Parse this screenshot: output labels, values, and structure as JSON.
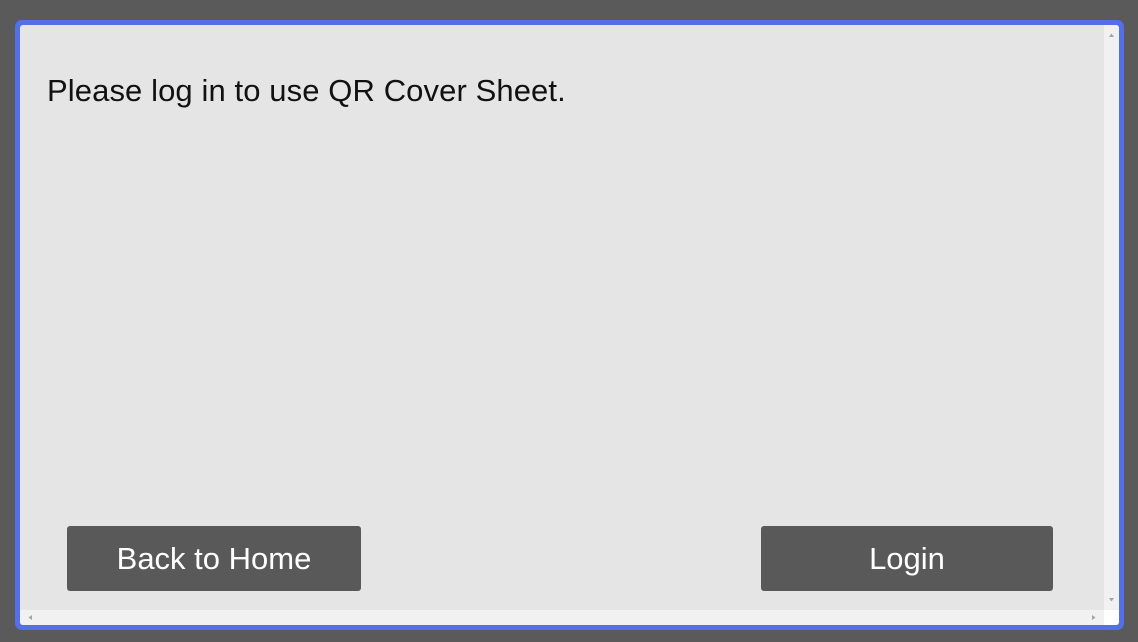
{
  "dialog": {
    "message": "Please log in to use QR Cover Sheet.",
    "back_label": "Back to Home",
    "login_label": "Login"
  },
  "colors": {
    "background": "#5a5a5a",
    "frame_border": "#5470e8",
    "panel": "#e5e5e5",
    "button": "#595959",
    "button_text": "#ffffff"
  },
  "icons": {
    "scroll_up": "scroll-up-arrow-icon",
    "scroll_down": "scroll-down-arrow-icon",
    "scroll_left": "scroll-left-arrow-icon",
    "scroll_right": "scroll-right-arrow-icon"
  }
}
